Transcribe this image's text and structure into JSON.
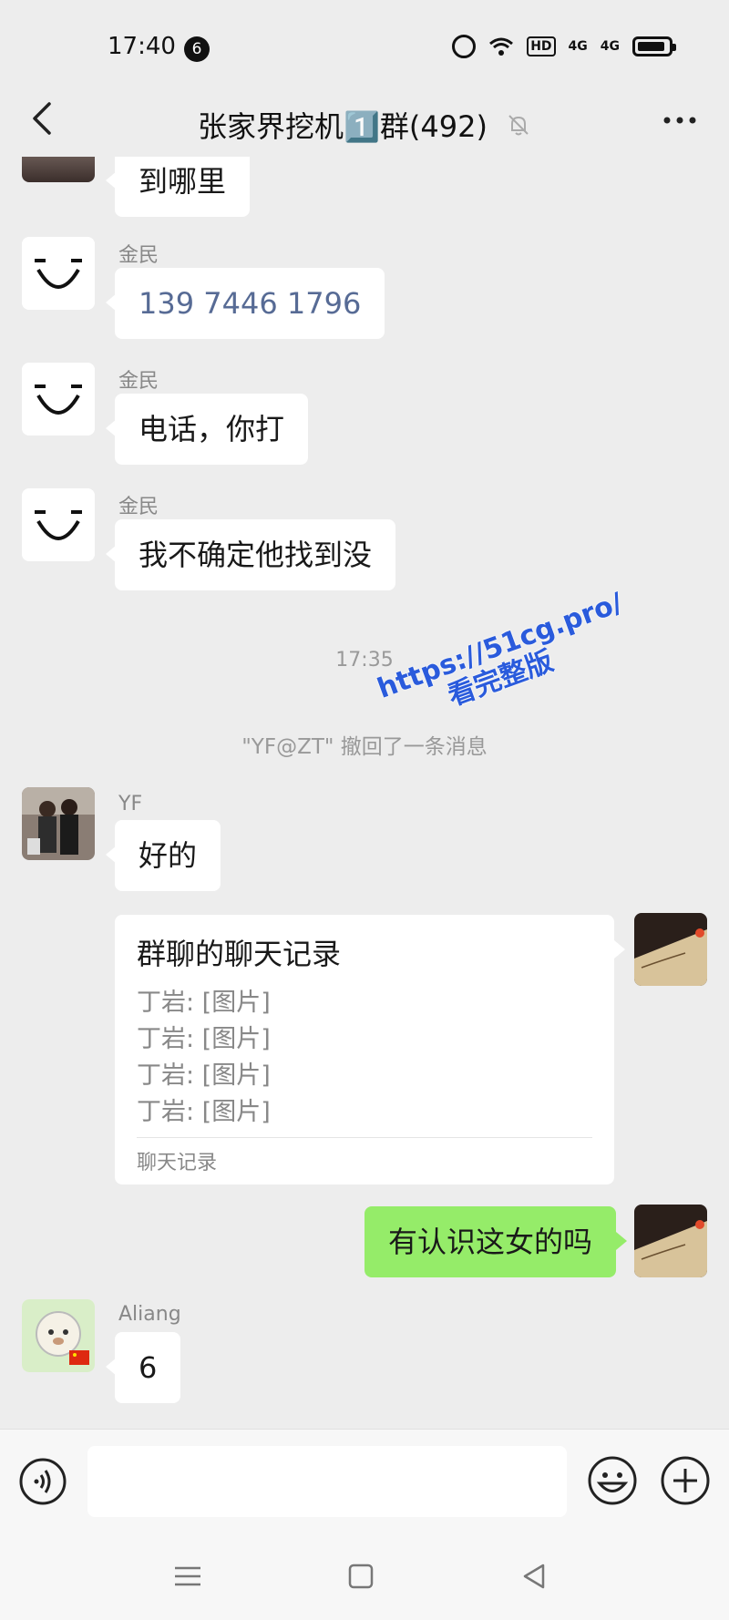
{
  "status_bar": {
    "time": "17:40",
    "notification_count": "6",
    "icons": [
      "alarm-icon",
      "wifi-icon",
      "hd-icon",
      "signal-4g-icon",
      "signal-4g-icon",
      "battery-icon"
    ],
    "hd_label": "HD",
    "sig1": "4G",
    "sig2": "4G"
  },
  "header": {
    "title": "张家界挖机1️⃣群(492)",
    "icons": [
      "back-arrow-icon",
      "mute-bell-icon",
      "more-dots-icon"
    ]
  },
  "messages": [
    {
      "sender": "",
      "text": "到哪里"
    },
    {
      "sender": "金民",
      "text": "139 7446 1796"
    },
    {
      "sender": "金民",
      "text": "电话，你打"
    },
    {
      "sender": "金民",
      "text": "我不确定他找到没"
    },
    {
      "time": "17:35"
    },
    {
      "system": "\"YF@ZT\" 撤回了一条消息"
    },
    {
      "sender": "YF",
      "text": "好的"
    },
    {
      "card": {
        "title": "群聊的聊天记录",
        "lines": [
          "丁岩: [图片]",
          "丁岩: [图片]",
          "丁岩: [图片]",
          "丁岩: [图片]"
        ],
        "footer": "聊天记录"
      }
    },
    {
      "self_text": "有认识这女的吗"
    },
    {
      "sender": "Aliang",
      "text": "6"
    }
  ],
  "watermark": {
    "line1": "https://51cg.pro/",
    "line2": "看完整版"
  },
  "input_bar": {
    "icons": [
      "voice-icon",
      "emoji-icon",
      "plus-icon"
    ]
  },
  "system_nav": {
    "icons": [
      "menu-icon",
      "home-icon",
      "back-triangle-icon"
    ]
  },
  "colors": {
    "background": "#ededed",
    "self_bubble": "#95ec69",
    "link": "#576b95"
  }
}
